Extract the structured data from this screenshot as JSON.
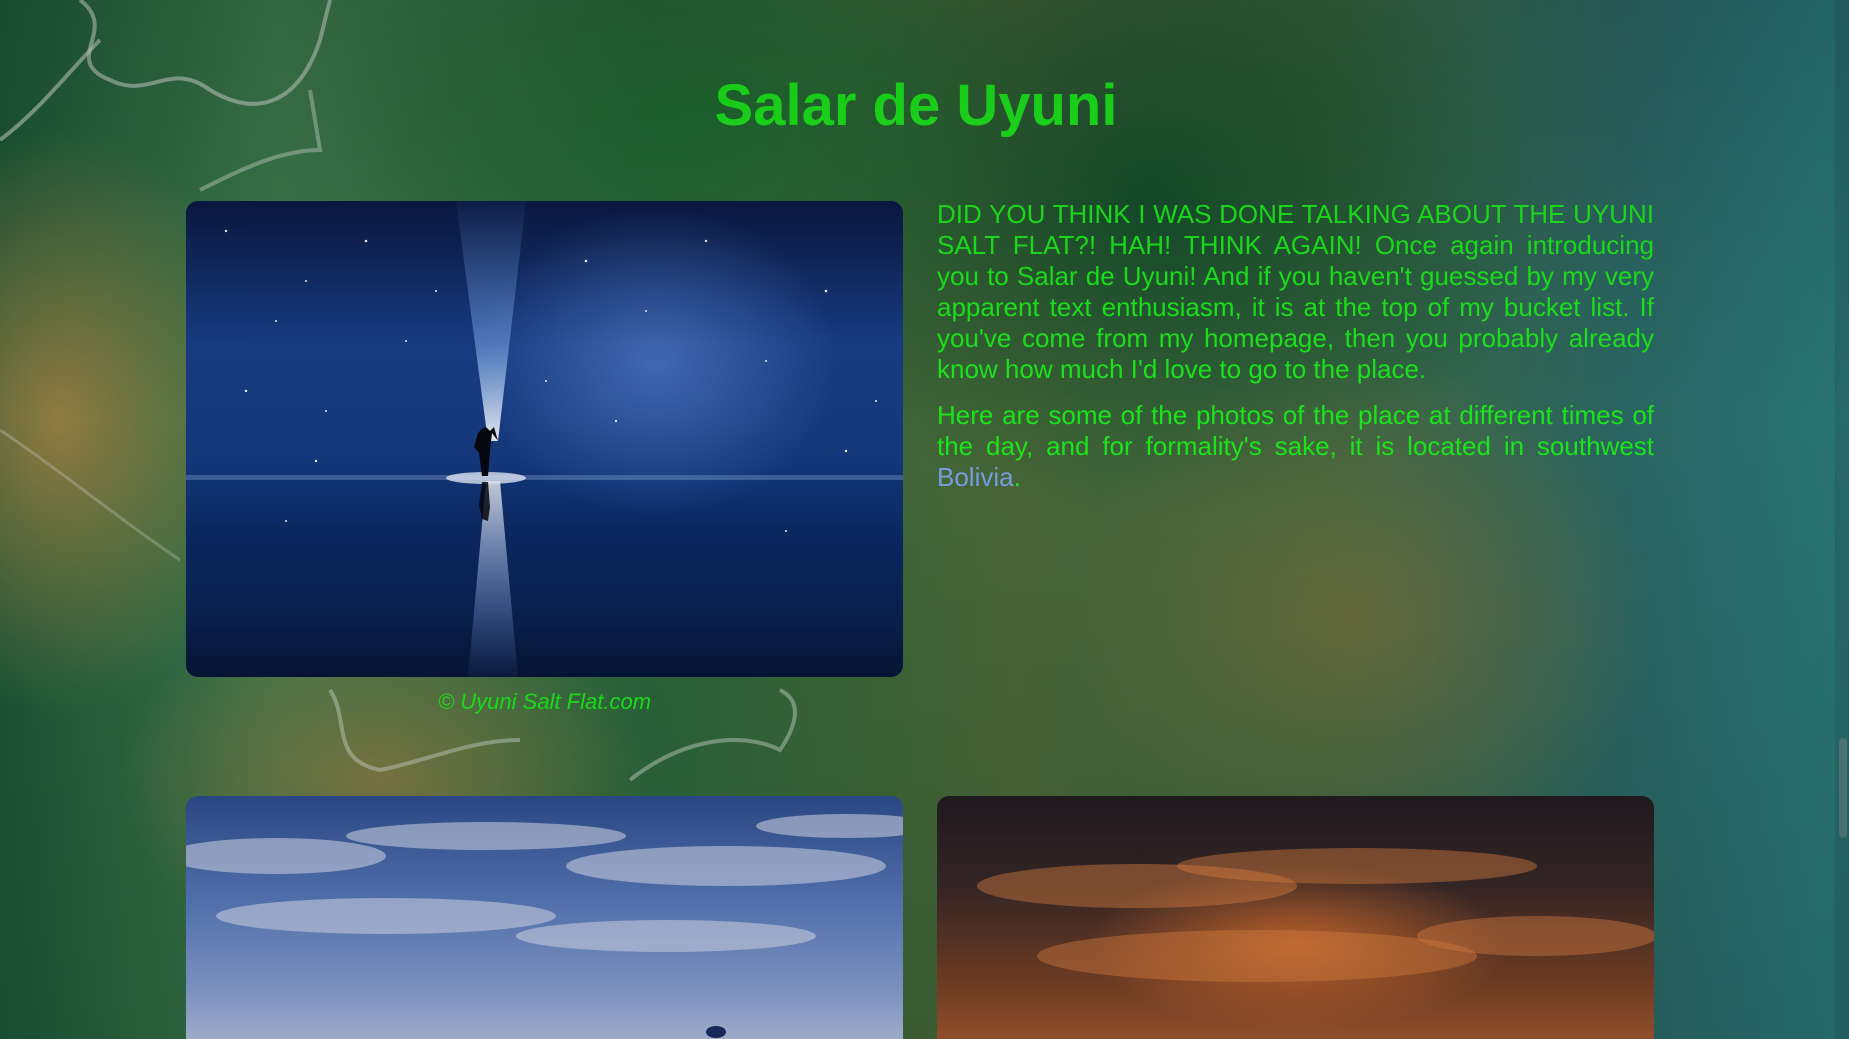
{
  "page": {
    "title": "Salar de Uyuni"
  },
  "photos": {
    "night_caption": "© Uyuni Salt Flat.com"
  },
  "content": {
    "paragraph_1": "DID YOU THINK I WAS DONE TALKING ABOUT THE UYUNI SALT FLAT?! HAH! THINK AGAIN! Once again introducing you to Salar de Uyuni! And if you haven't guessed by my very apparent text enthusiasm, it is at the top of my bucket list. If you've come from my homepage, then you probably already know how much I'd love to go to the place.",
    "paragraph_2_before_link": "Here are some of the photos of the place at different times of the day, and for formality's sake, it is located in southwest ",
    "link_text": "Bolivia",
    "paragraph_2_after_link": "."
  },
  "colors": {
    "heading_text": "#1ef01e",
    "link": "#7fa6ea"
  }
}
